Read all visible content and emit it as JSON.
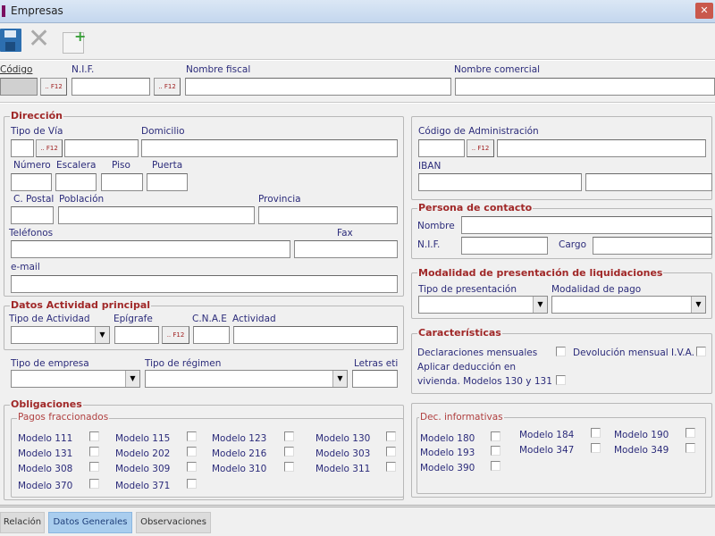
{
  "window": {
    "title": "Empresas",
    "close": "✕"
  },
  "toolbar": {
    "save": "save",
    "delete": "delete",
    "new": "new"
  },
  "header": {
    "codigo": "Código",
    "nif": "N.I.F.",
    "nombre_fiscal": "Nombre fiscal",
    "nombre_comercial": "Nombre comercial",
    "f12": ".. F12"
  },
  "direccion": {
    "title": "Dirección",
    "tipo_via": "Tipo de Vía",
    "domicilio": "Domicilio",
    "numero": "Número",
    "escalera": "Escalera",
    "piso": "Piso",
    "puerta": "Puerta",
    "cpostal": "C. Postal",
    "poblacion": "Población",
    "provincia": "Provincia",
    "telefonos": "Teléfonos",
    "fax": "Fax",
    "email": "e-mail"
  },
  "actividad": {
    "title": "Datos Actividad principal",
    "tipo": "Tipo de Actividad",
    "epigrafe": "Epígrafe",
    "cnae": "C.N.A.E",
    "actividad": "Actividad"
  },
  "empresa": {
    "tipo_empresa": "Tipo de empresa",
    "tipo_regimen": "Tipo de régimen",
    "letras": "Letras eti"
  },
  "obligaciones": {
    "title": "Obligaciones",
    "pagos": "Pagos fraccionados",
    "modelos": [
      "Modelo 111",
      "Modelo 115",
      "Modelo 123",
      "Modelo 130",
      "Modelo 131",
      "Modelo 202",
      "Modelo 216",
      "Modelo 303",
      "Modelo 308",
      "Modelo 309",
      "Modelo 310",
      "Modelo 311",
      "Modelo 370",
      "Modelo 371"
    ]
  },
  "administracion": {
    "codigo": "Código de Administración",
    "iban": "IBAN"
  },
  "contacto": {
    "title": "Persona de contacto",
    "nombre": "Nombre",
    "nif": "N.I.F.",
    "cargo": "Cargo"
  },
  "modalidad": {
    "title": "Modalidad de presentación de liquidaciones",
    "tipo": "Tipo de presentación",
    "pago": "Modalidad de pago"
  },
  "caracteristicas": {
    "title": "Características",
    "decl": "Declaraciones mensuales",
    "devol": "Devolución mensual I.V.A.",
    "aplicar1": "Aplicar deducción en",
    "aplicar2": "vivienda. Modelos 130 y 131"
  },
  "dec_informativas": {
    "title": "Dec. informativas",
    "modelos": [
      "Modelo 180",
      "Modelo 193",
      "Modelo 390",
      "Modelo 184",
      "Modelo 347",
      "Modelo 190",
      "Modelo 349"
    ]
  },
  "tabs": [
    "Relación",
    "Datos Generales",
    "Observaciones"
  ]
}
